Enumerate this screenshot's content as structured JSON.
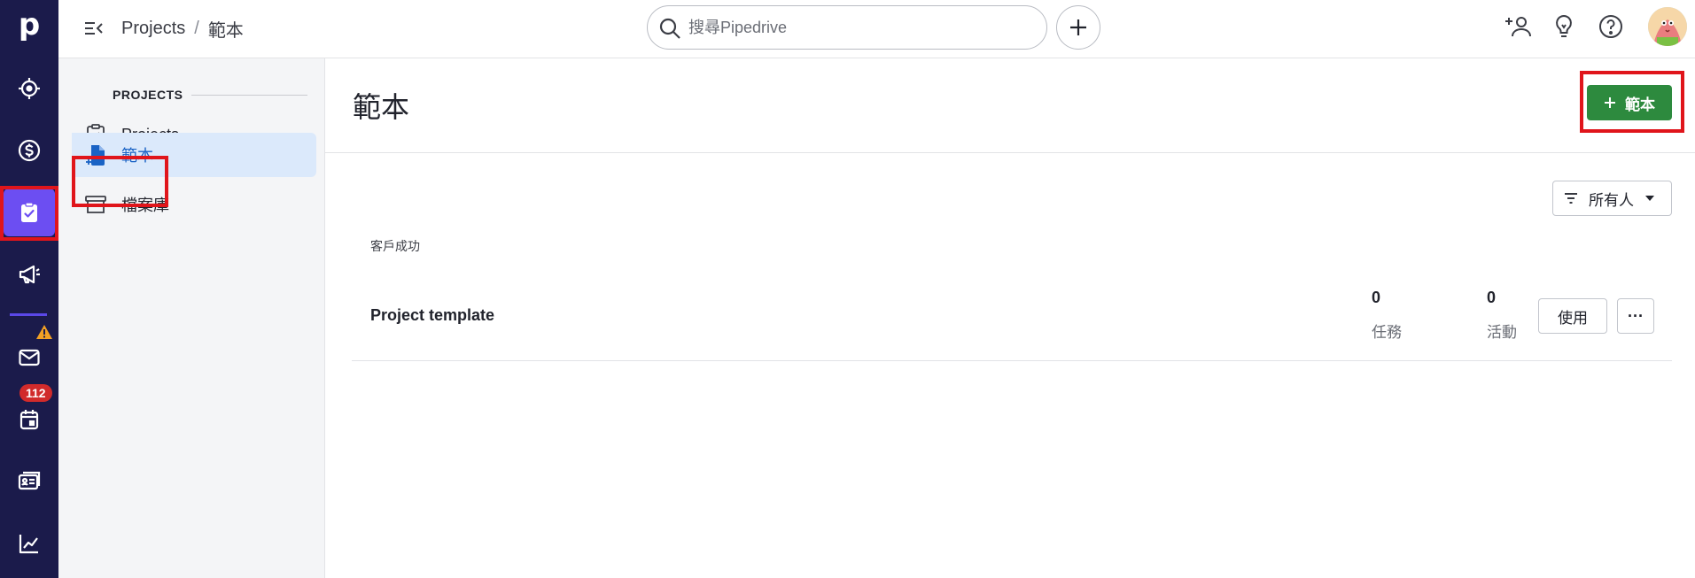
{
  "brand": {
    "logo_letter": "p",
    "accent": "#6c4ef2",
    "rail_bg": "#1b1b4b",
    "primary_green": "#2d8a3e",
    "highlight_red": "#e0151b"
  },
  "rail": {
    "items": [
      {
        "name": "focus",
        "icon": "target-icon"
      },
      {
        "name": "deals",
        "icon": "dollar-icon"
      },
      {
        "name": "projects",
        "icon": "clipboard-check-icon",
        "active": true
      },
      {
        "name": "campaigns",
        "icon": "megaphone-icon"
      },
      {
        "name": "mail",
        "icon": "mail-icon",
        "warning": true
      },
      {
        "name": "activities",
        "icon": "calendar-icon",
        "badge": "112"
      },
      {
        "name": "contacts",
        "icon": "contact-card-icon"
      },
      {
        "name": "insights",
        "icon": "chart-icon"
      }
    ],
    "activities_badge": "112"
  },
  "topbar": {
    "breadcrumb": [
      "Projects",
      "範本"
    ],
    "breadcrumb_sep": "/",
    "search_placeholder": "搜尋Pipedrive"
  },
  "subnav": {
    "section_title": "PROJECTS",
    "items": [
      {
        "label": "Projects",
        "icon": "clipboard-check-icon"
      },
      {
        "label": "範本",
        "icon": "template-file-icon",
        "active": true
      },
      {
        "label": "檔案庫",
        "icon": "archive-icon"
      }
    ]
  },
  "main": {
    "title": "範本",
    "add_button_label": "範本",
    "filter_label": "所有人",
    "group_label": "客戶成功",
    "rows": [
      {
        "name": "Project template",
        "tasks_count": "0",
        "tasks_label": "任務",
        "activities_count": "0",
        "activities_label": "活動",
        "use_label": "使用",
        "more_label": "···"
      }
    ]
  }
}
